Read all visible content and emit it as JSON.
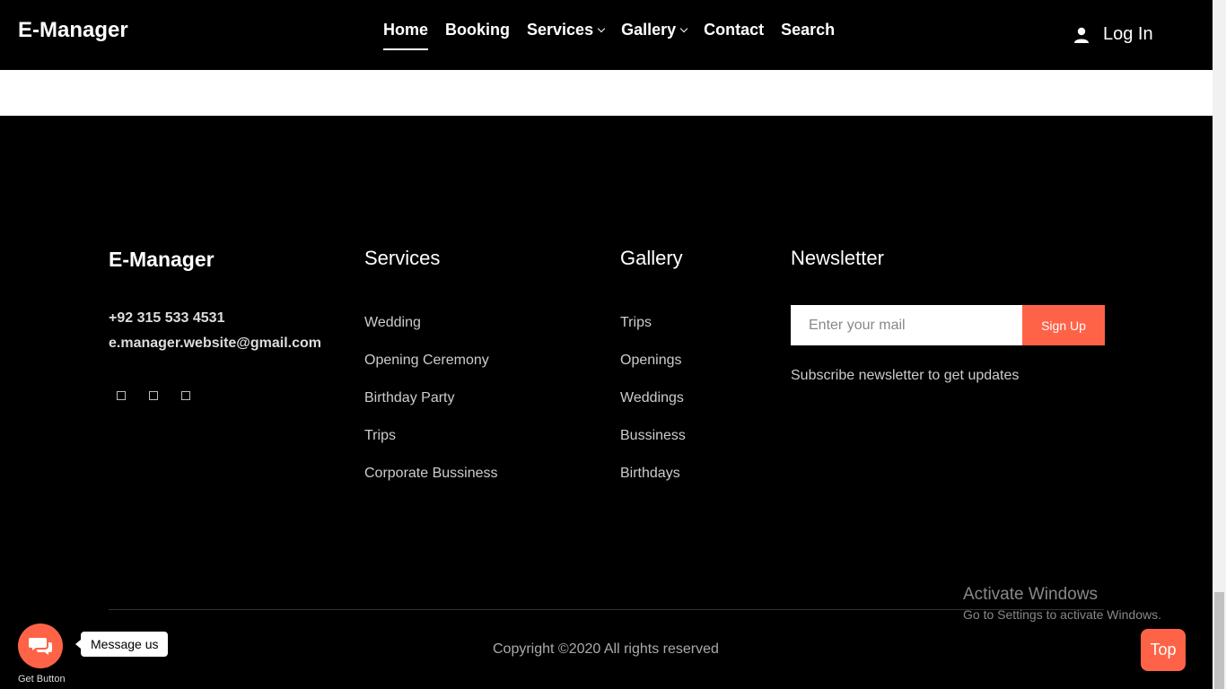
{
  "header": {
    "brand": "E-Manager",
    "nav": [
      "Home",
      "Booking",
      "Services",
      "Gallery",
      "Contact",
      "Search"
    ],
    "login": "Log In"
  },
  "footer": {
    "brand": "E-Manager",
    "phone": "+92 315 533 4531",
    "email": "e.manager.website@gmail.com",
    "services_title": "Services",
    "services": [
      "Wedding",
      "Opening Ceremony",
      "Birthday Party",
      "Trips",
      "Corporate Bussiness"
    ],
    "gallery_title": "Gallery",
    "gallery": [
      "Trips",
      "Openings",
      "Weddings",
      "Bussiness",
      "Birthdays"
    ],
    "newsletter_title": "Newsletter",
    "newsletter_placeholder": "Enter your mail",
    "newsletter_button": "Sign Up",
    "newsletter_text": "Subscribe newsletter to get updates",
    "copyright": "Copyright ©2020 All rights reserved"
  },
  "overlay": {
    "activate_title": "Activate Windows",
    "activate_sub": "Go to Settings to activate Windows.",
    "top_button": "Top",
    "chat_label": "Get Button",
    "message": "Message us"
  },
  "colors": {
    "accent": "#ff6347"
  }
}
